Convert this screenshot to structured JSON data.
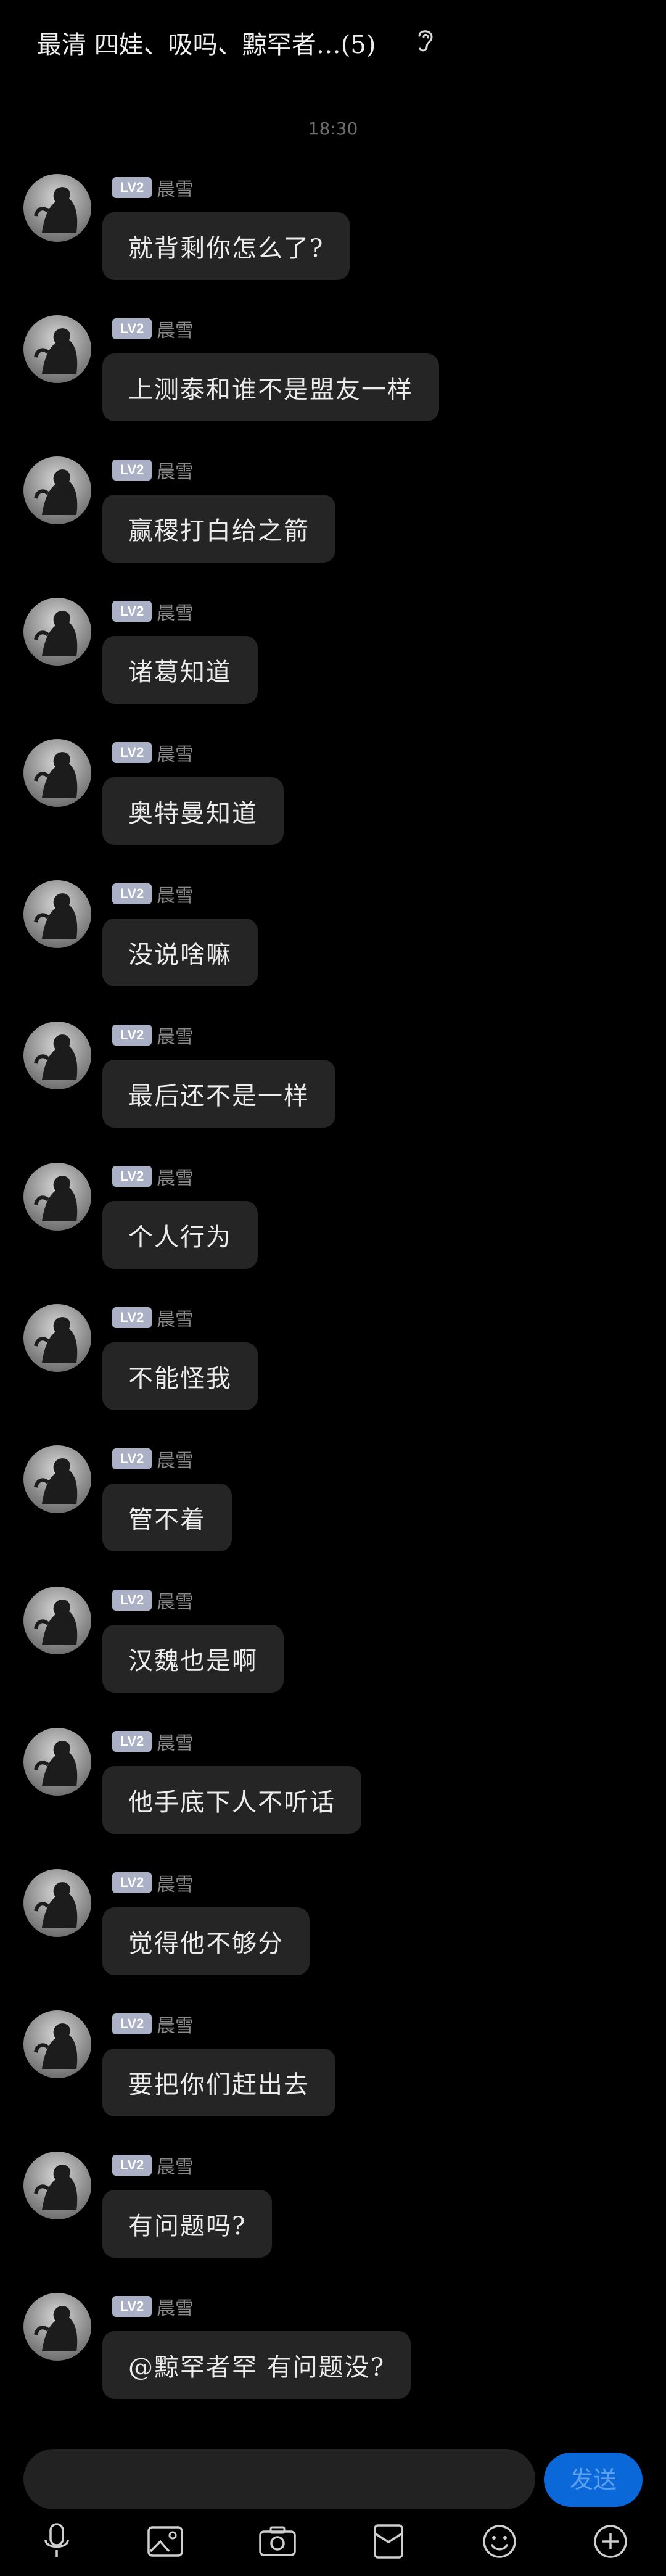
{
  "header": {
    "title": "最清  四娃、吸吗、黥罕者…(5)",
    "ear_icon": "ear-icon"
  },
  "timestamp": "18:30",
  "sender": {
    "level": "LV2",
    "name": "晨雪"
  },
  "messages": [
    {
      "text": "就背剩你怎么了?"
    },
    {
      "text": "上测泰和谁不是盟友一样"
    },
    {
      "text": "赢稷打白给之箭"
    },
    {
      "text": "诸葛知道"
    },
    {
      "text": "奥特曼知道"
    },
    {
      "text": "没说啥嘛"
    },
    {
      "text": "最后还不是一样"
    },
    {
      "text": "个人行为"
    },
    {
      "text": "不能怪我"
    },
    {
      "text": "管不着"
    },
    {
      "text": "汉魏也是啊"
    },
    {
      "text": "他手底下人不听话"
    },
    {
      "text": "觉得他不够分"
    },
    {
      "text": "要把你们赶出去"
    },
    {
      "text": "有问题吗?"
    },
    {
      "text": "@黥罕者罕 有问题没?"
    }
  ],
  "input": {
    "placeholder": ""
  },
  "send_label": "发送",
  "toolbar": {
    "items": [
      "microphone-icon",
      "image-icon",
      "camera-icon",
      "red-packet-icon",
      "emoji-icon",
      "plus-icon"
    ]
  },
  "colors": {
    "background": "#000000",
    "bubble": "#252525",
    "badge": "#aab0c6",
    "send_button": "#0a68d8"
  }
}
